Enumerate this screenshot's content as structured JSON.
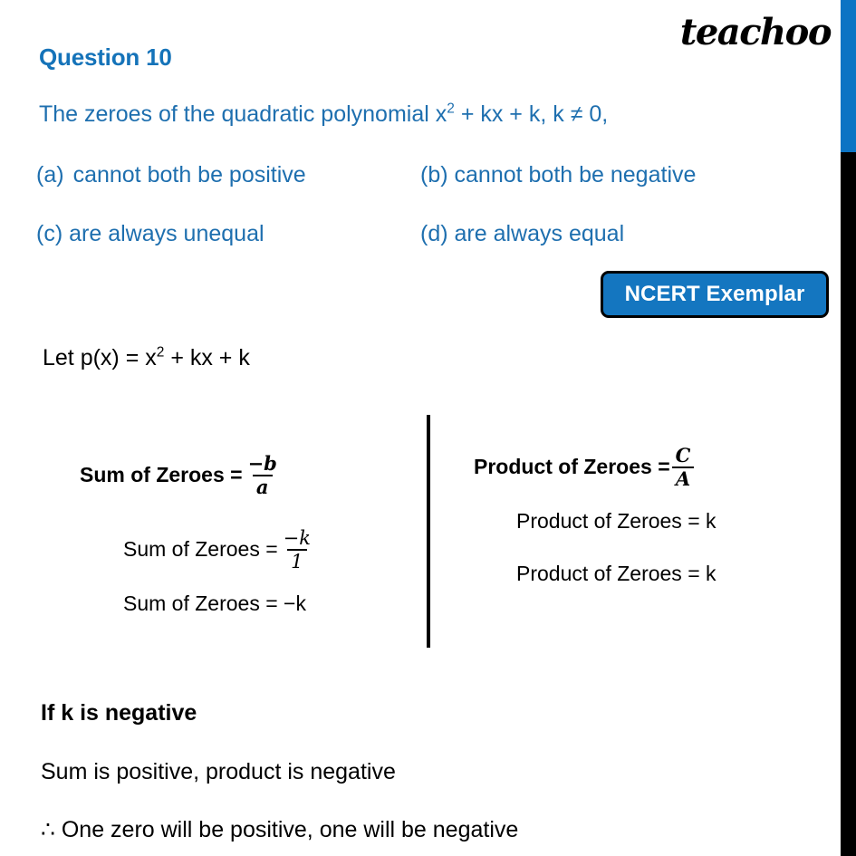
{
  "brand": {
    "logo_text": "teachoo"
  },
  "question": {
    "heading": "Question 10",
    "statement_prefix": "The zeroes of the quadratic polynomial x",
    "statement_sup": "2",
    "statement_suffix": " + kx + k,  k ≠ 0,",
    "options": [
      {
        "label": "(a)",
        "text": "cannot both be positive"
      },
      {
        "label": "(b)",
        "text": "cannot both be negative"
      },
      {
        "label": "(c)",
        "text": "are always unequal"
      },
      {
        "label": "(d)",
        "text": "are always equal"
      }
    ]
  },
  "badge": {
    "label": "NCERT Exemplar"
  },
  "solution": {
    "let_prefix": "Let p(x) = x",
    "let_sup": "2",
    "let_suffix": " + kx + k",
    "sum_column": {
      "formula_label": "Sum of Zeroes = ",
      "formula_num": "−b",
      "formula_den": "a",
      "step1_label": "Sum of Zeroes = ",
      "step1_num": "−k",
      "step1_den": "1",
      "step2": "Sum of Zeroes = −k"
    },
    "product_column": {
      "formula_label": "Product of Zeroes = ",
      "formula_num": "C",
      "formula_den": "A",
      "step1": "Product of Zeroes = k",
      "step2": "Product of Zeroes = k"
    }
  },
  "conclusion": {
    "case_heading": "If k is negative",
    "observation": "Sum is positive, product is negative",
    "result": "∴ One zero will be positive, one will be negative"
  },
  "colors": {
    "heading_blue": "#1573B9",
    "body_blue": "#1E6FAF",
    "badge_blue": "#1476C0",
    "scrollbar_thumb": "#0C74C4",
    "scrollbar_track": "#000000",
    "text_black": "#000000",
    "page_background": "#FFFFFF"
  }
}
